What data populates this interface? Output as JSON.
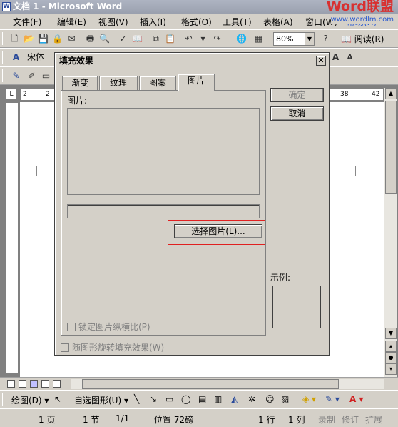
{
  "window": {
    "title": "文档 1 - Microsoft Word"
  },
  "brand": {
    "logo_text": "Word联盟",
    "url_text": "www.wordlm.com"
  },
  "menu": [
    "文件(F)",
    "编辑(E)",
    "视图(V)",
    "插入(I)",
    "格式(O)",
    "工具(T)",
    "表格(A)",
    "窗口(W)",
    "帮助(H)"
  ],
  "toolbar": {
    "zoom": "80%",
    "read_label": "阅读(R)"
  },
  "format_bar": {
    "font_name": "宋体"
  },
  "ruler": {
    "left_labels": [
      "2",
      "2"
    ],
    "right_labels": [
      "38",
      "42"
    ]
  },
  "dialog": {
    "title": "填充效果",
    "tabs": [
      "渐变",
      "纹理",
      "图案",
      "图片"
    ],
    "active_tab": "图片",
    "picture_label": "图片:",
    "select_button": "选择图片(L)...",
    "lock_aspect_label": "锁定图片纵横比(P)",
    "rotate_label": "随图形旋转填充效果(W)",
    "ok_button": "确定",
    "cancel_button": "取消",
    "sample_label": "示例:"
  },
  "drawbar": {
    "draw_label": "绘图(D)",
    "autoshapes_label": "自选图形(U)"
  },
  "status": {
    "page": "1 页",
    "section": "1 节",
    "page_of": "1/1",
    "position": "位置 72磅",
    "line": "1 行",
    "column": "1 列",
    "rec": "录制",
    "trk": "修订",
    "ext": "扩展"
  }
}
